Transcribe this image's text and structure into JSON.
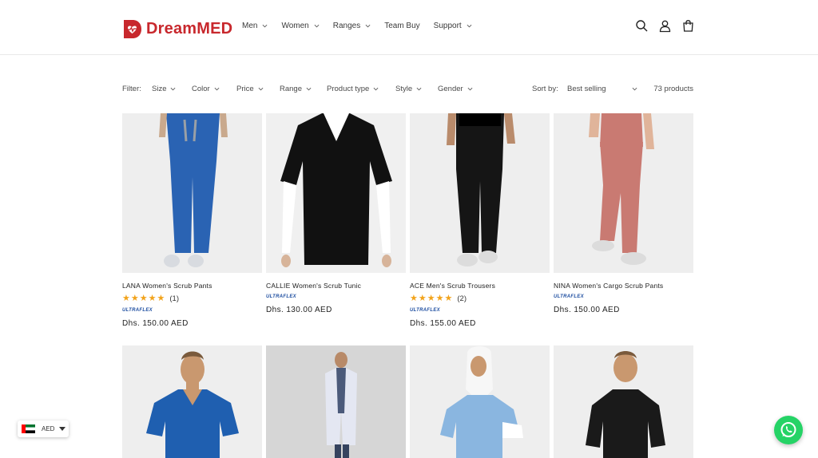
{
  "brand": {
    "name": "DreamMED",
    "color": "#c8282d"
  },
  "nav": [
    {
      "label": "Men",
      "has_dropdown": true
    },
    {
      "label": "Women",
      "has_dropdown": true
    },
    {
      "label": "Ranges",
      "has_dropdown": true
    },
    {
      "label": "Team Buy",
      "has_dropdown": false
    },
    {
      "label": "Support",
      "has_dropdown": true
    }
  ],
  "header_icons": [
    "search-icon",
    "account-icon",
    "cart-icon"
  ],
  "filters": {
    "label": "Filter:",
    "facets": [
      "Size",
      "Color",
      "Price",
      "Range",
      "Product type",
      "Style",
      "Gender"
    ],
    "sort_label": "Sort by:",
    "sort_value": "Best selling",
    "product_count": "73 products"
  },
  "products": [
    {
      "title": "LANA Women's Scrub Pants",
      "rating": 5,
      "rating_count": "(1)",
      "brand": "ULTRAFLEX",
      "price": "Dhs. 150.00 AED",
      "color": "#2a63b3"
    },
    {
      "title": "CALLIE Women's Scrub Tunic",
      "rating": null,
      "rating_count": "",
      "brand": "ULTRAFLEX",
      "price": "Dhs. 130.00 AED",
      "color": "#111111"
    },
    {
      "title": "ACE Men's Scrub Trousers",
      "rating": 5,
      "rating_count": "(2)",
      "brand": "ULTRAFLEX",
      "price": "Dhs. 155.00 AED",
      "color": "#151515"
    },
    {
      "title": "NINA Women's Cargo Scrub Pants",
      "rating": null,
      "rating_count": "",
      "brand": "ULTRAFLEX",
      "price": "Dhs. 150.00 AED",
      "color": "#c97a72"
    },
    {
      "title": "",
      "color": "#1f5fb0"
    },
    {
      "title": "",
      "color": "#e4e7f2"
    },
    {
      "title": "",
      "color": "#8ab6e0"
    },
    {
      "title": "",
      "color": "#1a1a1a"
    }
  ],
  "currency": {
    "code": "AED",
    "flag": "uae-flag-icon"
  },
  "whatsapp": {
    "icon": "whatsapp-icon",
    "color": "#25d366"
  }
}
